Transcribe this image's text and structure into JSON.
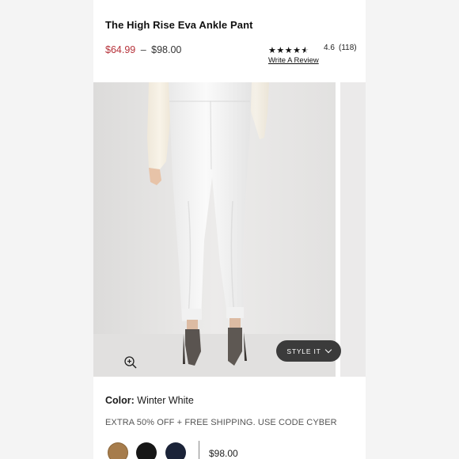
{
  "product": {
    "title": "The High Rise Eva Ankle Pant",
    "sale_price": "$64.99",
    "price_separator": "–",
    "regular_price": "$98.00"
  },
  "rating": {
    "value": "4.6",
    "count": "(118)",
    "stars": 4.6,
    "write_review": "Write A Review"
  },
  "image": {
    "alt": "Model wearing winter white ankle pants with silk blouse and snakeskin heels",
    "zoom_icon": "zoom-in-icon"
  },
  "style_it": {
    "label": "STYLE IT",
    "icon": "chevron-down-icon"
  },
  "color": {
    "label": "Color:",
    "selected": "Winter White"
  },
  "promo": "EXTRA 50% OFF + FREE SHIPPING. USE CODE CYBER",
  "swatches": [
    {
      "name": "camel",
      "color": "#a67c4c"
    },
    {
      "name": "black",
      "color": "#161616"
    },
    {
      "name": "navy",
      "color": "#1b2338"
    }
  ],
  "swatch_price": "$98.00"
}
